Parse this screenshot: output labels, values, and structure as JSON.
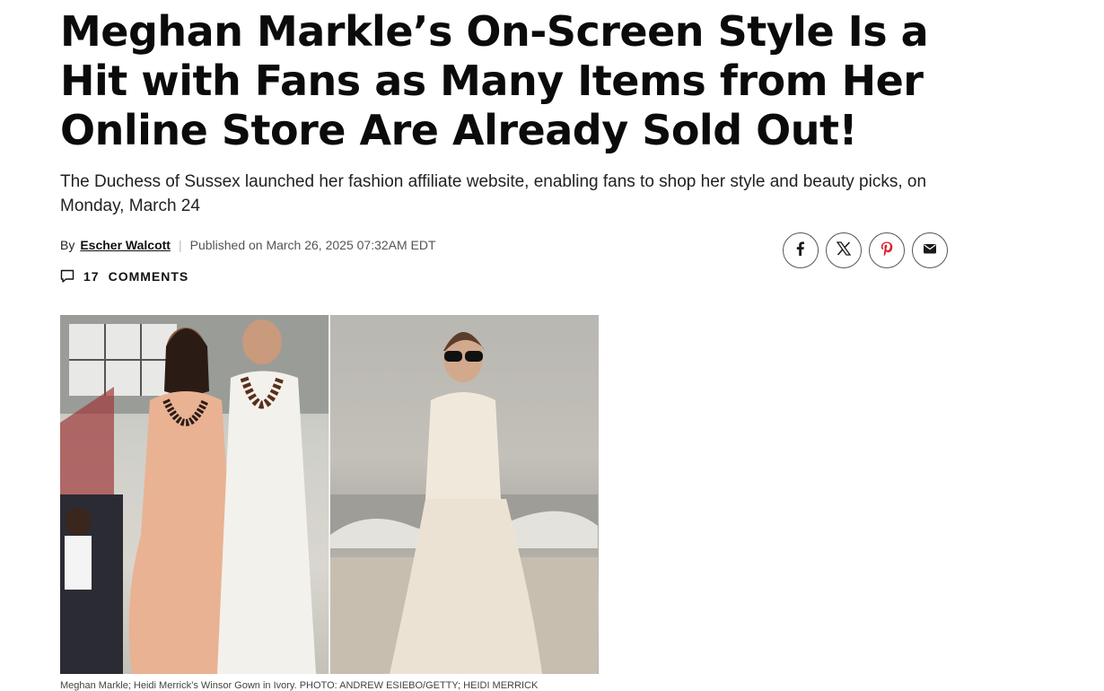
{
  "article": {
    "headline": "Meghan Markle’s On-Screen Style Is a Hit with Fans as Many Items from Her Online Store Are Already Sold Out!",
    "dek": "The Duchess of Sussex launched her fashion affiliate website, enabling fans to shop her style and beauty picks, on Monday, March 24",
    "byline": {
      "by_label": "By",
      "author": "Escher Walcott",
      "published": "Published on March 26, 2025 07:32AM EDT"
    },
    "comments": {
      "count": "17",
      "label": "COMMENTS"
    },
    "share_icons": [
      "facebook-icon",
      "x-icon",
      "pinterest-icon",
      "email-icon"
    ],
    "share_icon_color": "#1a1a1a",
    "photo": {
      "caption": "Meghan Markle; Heidi Merrick’s Winsor Gown in Ivory. PHOTO: ANDREW ESIEBO/GETTY; HEIDI MERRICK"
    }
  }
}
